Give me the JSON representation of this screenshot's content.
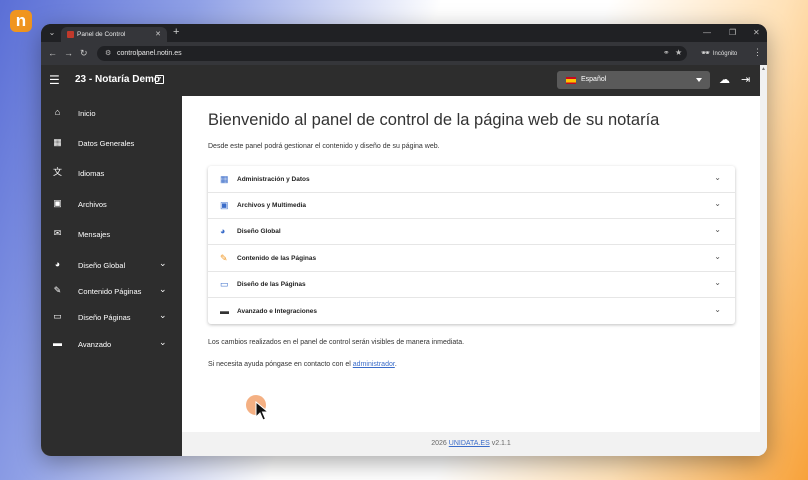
{
  "browser": {
    "tab_title": "Panel de Control",
    "url": "controlpanel.notin.es",
    "incognito_label": "Incógnito"
  },
  "app": {
    "title": "23 - Notaría Demo",
    "language": "Español"
  },
  "sidebar": {
    "items": [
      {
        "label": "Inicio",
        "icon": "home-icon",
        "expandable": false
      },
      {
        "label": "Datos Generales",
        "icon": "grid-icon",
        "expandable": false
      },
      {
        "label": "Idiomas",
        "icon": "translate-icon",
        "expandable": false
      },
      {
        "label": "Archivos",
        "icon": "image-library-icon",
        "expandable": false
      },
      {
        "label": "Mensajes",
        "icon": "mail-icon",
        "expandable": false
      },
      {
        "label": "Diseño Global",
        "icon": "palette-icon",
        "expandable": true
      },
      {
        "label": "Contenido Páginas",
        "icon": "edit-document-icon",
        "expandable": true
      },
      {
        "label": "Diseño Páginas",
        "icon": "monitor-icon",
        "expandable": true
      },
      {
        "label": "Avanzado",
        "icon": "toolbox-icon",
        "expandable": true
      }
    ]
  },
  "main": {
    "heading": "Bienvenido al panel de control de la página web de su notaría",
    "intro": "Desde este panel podrá gestionar el contenido y diseño de su página web.",
    "sections": [
      {
        "label": "Administración y Datos",
        "icon": "grid-icon",
        "color": "#3a6cc9"
      },
      {
        "label": "Archivos y Multimedia",
        "icon": "image-library-icon",
        "color": "#3a6cc9"
      },
      {
        "label": "Diseño Global",
        "icon": "palette-icon",
        "color": "#3a6cc9"
      },
      {
        "label": "Contenido de las Páginas",
        "icon": "edit-document-icon",
        "color": "#f0951f"
      },
      {
        "label": "Diseño de las Páginas",
        "icon": "monitor-icon",
        "color": "#3a6cc9"
      },
      {
        "label": "Avanzado e Integraciones",
        "icon": "toolbox-icon",
        "color": "#333333"
      }
    ],
    "note": "Los cambios realizados en el panel de control serán visibles de manera inmediata.",
    "help_prefix": "Si necesita ayuda póngase en contacto con el ",
    "help_link": "administrador",
    "help_suffix": "."
  },
  "footer": {
    "year": "2026",
    "link": "UNIDATA.ES",
    "version": "v2.1.1"
  },
  "colors": {
    "topbar": "#2d2d2d",
    "sidebar": "#2d2d2d",
    "link": "#3a6cc9",
    "brand_orange": "#f0951f"
  }
}
